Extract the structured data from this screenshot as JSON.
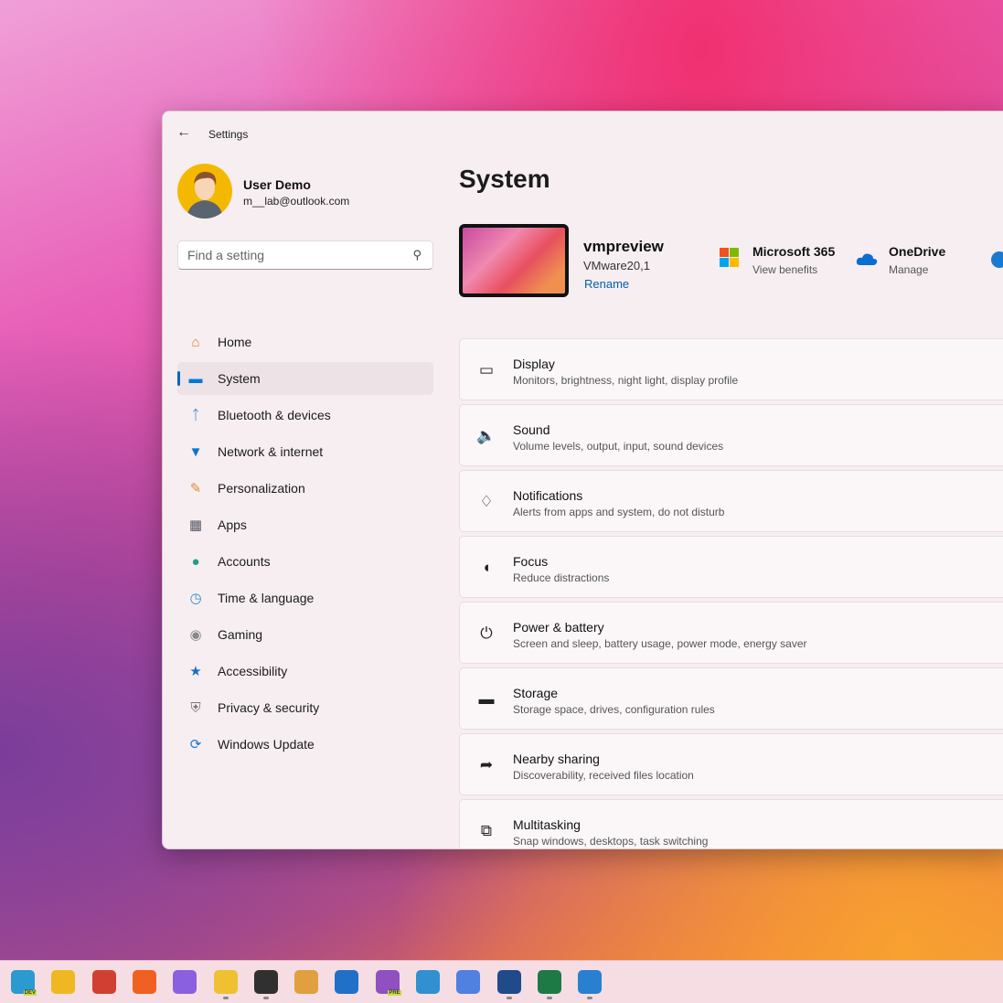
{
  "window": {
    "title": "Settings",
    "back_icon": "arrow-left-icon"
  },
  "user": {
    "name": "User Demo",
    "email": "m__lab@outlook.com"
  },
  "search": {
    "placeholder": "Find a setting"
  },
  "nav": [
    {
      "label": "Home",
      "icon": "home-icon",
      "color": "#e07a30"
    },
    {
      "label": "System",
      "icon": "system-icon",
      "color": "#0078d4",
      "selected": true
    },
    {
      "label": "Bluetooth & devices",
      "icon": "bluetooth-icon",
      "color": "#0078d4"
    },
    {
      "label": "Network & internet",
      "icon": "wifi-icon",
      "color": "#0a74d0"
    },
    {
      "label": "Personalization",
      "icon": "brush-icon",
      "color": "#e08a30"
    },
    {
      "label": "Apps",
      "icon": "apps-icon",
      "color": "#556"
    },
    {
      "label": "Accounts",
      "icon": "accounts-icon",
      "color": "#20a080"
    },
    {
      "label": "Time & language",
      "icon": "globe-clock-icon",
      "color": "#2a8ad0"
    },
    {
      "label": "Gaming",
      "icon": "gamepad-icon",
      "color": "#888"
    },
    {
      "label": "Accessibility",
      "icon": "accessibility-icon",
      "color": "#1a6ec8"
    },
    {
      "label": "Privacy & security",
      "icon": "shield-icon",
      "color": "#777"
    },
    {
      "label": "Windows Update",
      "icon": "update-icon",
      "color": "#1a7ad0"
    }
  ],
  "main": {
    "title": "System",
    "device": {
      "name": "vmpreview",
      "model": "VMware20,1",
      "rename": "Rename"
    },
    "services": [
      {
        "title": "Microsoft 365",
        "subtitle": "View benefits",
        "icon": "microsoft-logo-icon"
      },
      {
        "title": "OneDrive",
        "subtitle": "Manage",
        "icon": "onedrive-cloud-icon"
      }
    ],
    "cards": [
      {
        "title": "Display",
        "subtitle": "Monitors, brightness, night light, display profile",
        "icon": "laptop-icon"
      },
      {
        "title": "Sound",
        "subtitle": "Volume levels, output, input, sound devices",
        "icon": "speaker-icon"
      },
      {
        "title": "Notifications",
        "subtitle": "Alerts from apps and system, do not disturb",
        "icon": "bell-icon"
      },
      {
        "title": "Focus",
        "subtitle": "Reduce distractions",
        "icon": "focus-icon"
      },
      {
        "title": "Power & battery",
        "subtitle": "Screen and sleep, battery usage, power mode, energy saver",
        "icon": "power-icon"
      },
      {
        "title": "Storage",
        "subtitle": "Storage space, drives, configuration rules",
        "icon": "storage-icon"
      },
      {
        "title": "Nearby sharing",
        "subtitle": "Discoverability, received files location",
        "icon": "share-icon"
      },
      {
        "title": "Multitasking",
        "subtitle": "Snap windows, desktops, task switching",
        "icon": "multitasking-icon"
      }
    ]
  },
  "taskbar": [
    {
      "icon": "edge-dev-icon",
      "color": "#2a9ad0",
      "badge": "DEV"
    },
    {
      "icon": "chrome-canary-icon",
      "color": "#f0b820"
    },
    {
      "icon": "chrome-icon",
      "color": "#d04030"
    },
    {
      "icon": "firefox-icon",
      "color": "#f06020"
    },
    {
      "icon": "copilot-icon",
      "color": "#8a60e0"
    },
    {
      "icon": "file-explorer-icon",
      "color": "#f0c030",
      "running": true
    },
    {
      "icon": "terminal-icon",
      "color": "#303030",
      "running": true
    },
    {
      "icon": "dev-tools-icon",
      "color": "#e0a040"
    },
    {
      "icon": "web-file-icon",
      "color": "#2070c8"
    },
    {
      "icon": "dev-home-preview-icon",
      "color": "#9050c0",
      "badge": "PRE"
    },
    {
      "icon": "snipping-tool-icon",
      "color": "#3090d0"
    },
    {
      "icon": "sparkle-icon",
      "color": "#5080e0"
    },
    {
      "icon": "microsoft-store-icon",
      "color": "#204a8a",
      "running": true
    },
    {
      "icon": "excel-icon",
      "color": "#1e7a44",
      "running": true
    },
    {
      "icon": "resource-monitor-icon",
      "color": "#2a80d0",
      "running": true
    }
  ]
}
